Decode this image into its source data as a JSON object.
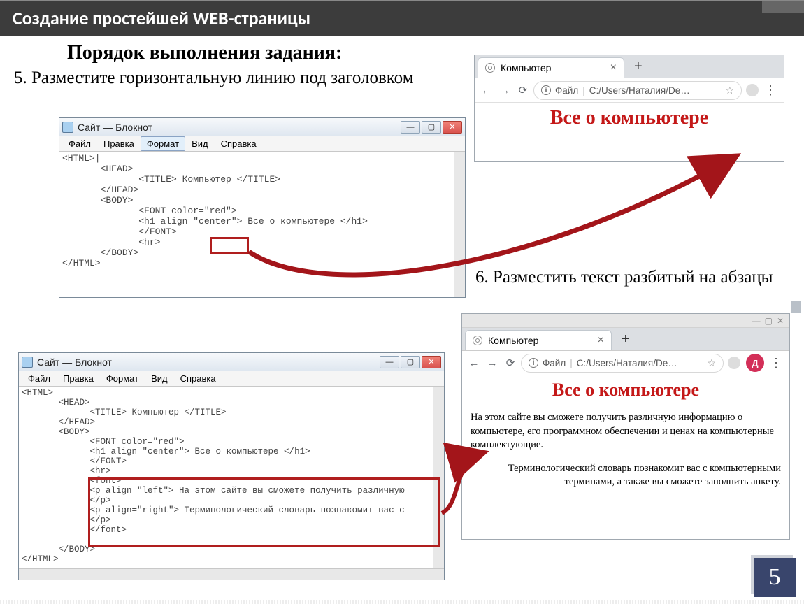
{
  "header": {
    "title": "Создание простейшей WEB-страницы"
  },
  "subtitle": "Порядок выполнения задания:",
  "steps": {
    "s5": "5. Разместите горизонтальную линию под заголовком",
    "s6": "6. Разместить текст разбитый на абзацы"
  },
  "notepad": {
    "title": "Сайт — Блокнот",
    "menu": {
      "file": "Файл",
      "edit": "Правка",
      "format": "Формат",
      "view": "Вид",
      "help": "Справка"
    },
    "code1": "<HTML>|\n       <HEAD>\n              <TITLE> Компьютер </TITLE>\n       </HEAD>\n       <BODY>\n              <FONT color=\"red\">\n              <h1 align=\"center\"> Все о компьютере </h1>\n              </FONT>\n              <hr>\n       </BODY>\n</HTML>",
    "code2": "<HTML>\n       <HEAD>\n             <TITLE> Компьютер </TITLE>\n       </HEAD>\n       <BODY>\n             <FONT color=\"red\">\n             <h1 align=\"center\"> Все о компьютере </h1>\n             </FONT>\n             <hr>\n             <font>\n             <p align=\"left\"> На этом сайте вы сможете получить различную \n             </p>\n             <p align=\"right\"> Терминологический словарь познакомит вас с \n             </p>\n             </font>\n\n       </BODY>\n</HTML>"
  },
  "browser": {
    "sys": {
      "min": "—",
      "max": "▢",
      "close": "✕"
    },
    "tab_title": "Компьютер",
    "plus": "+",
    "nav": {
      "back": "←",
      "fwd": "→",
      "reload": "⟳",
      "info": "i",
      "file_label": "Файл",
      "path": "C:/Users/Наталия/De…",
      "star": "☆",
      "avatar": "Д",
      "dots": "⋮"
    },
    "page": {
      "h1": "Все о компьютере",
      "p1": "На этом сайте вы сможете получить различную информацию о компьютере, его программном обеспечении и ценах на компьютерные комплектующие.",
      "p2": "Терминологический словарь познакомит вас с компьютерными терминами, а также вы сможете заполнить анкету."
    }
  },
  "footer": {
    "page": "5"
  }
}
